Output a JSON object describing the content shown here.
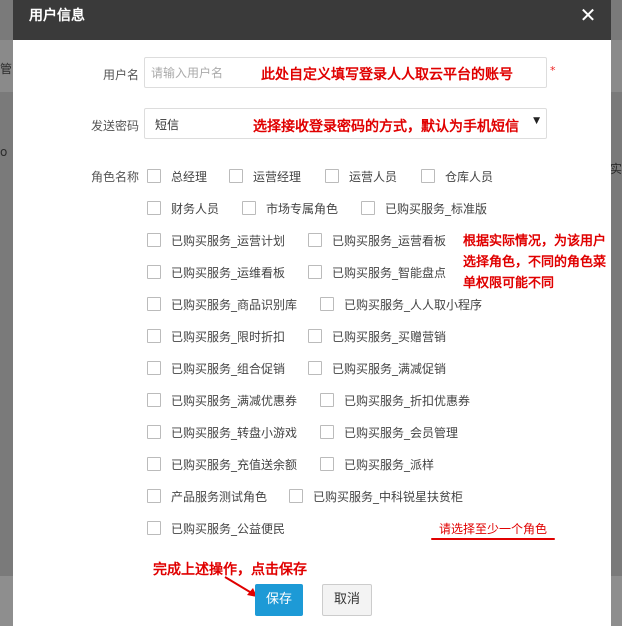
{
  "background": {
    "left_text": "管",
    "left_text2": "o",
    "right_text": "实"
  },
  "modal": {
    "title": "用户信息",
    "close_icon": "close-icon"
  },
  "form": {
    "username": {
      "label": "用户名",
      "placeholder": "请输入用户名",
      "required_mark": "*",
      "annotation": "此处自定义填写登录人人取云平台的账号"
    },
    "password_send": {
      "label": "发送密码",
      "value": "短信",
      "arrow": "▼",
      "annotation": "选择接收登录密码的方式，默认为手机短信"
    },
    "roles": {
      "label": "角色名称",
      "note": "根据实际情况，为该用户选择角色，不同的角色菜单权限可能不同",
      "hint": "请选择至少一个角色",
      "items": [
        "总经理",
        "运营经理",
        "运营人员",
        "仓库人员",
        "财务人员",
        "市场专属角色",
        "已购买服务_标准版",
        "已购买服务_运营计划",
        "已购买服务_运营看板",
        "已购买服务_运维看板",
        "已购买服务_智能盘点",
        "已购买服务_商品识别库",
        "已购买服务_人人取小程序",
        "已购买服务_限时折扣",
        "已购买服务_买赠营销",
        "已购买服务_组合促销",
        "已购买服务_满减促销",
        "已购买服务_满减优惠券",
        "已购买服务_折扣优惠券",
        "已购买服务_转盘小游戏",
        "已购买服务_会员管理",
        "已购买服务_充值送余额",
        "已购买服务_派样",
        "产品服务测试角色",
        "已购买服务_中科锐星扶贫柜",
        "已购买服务_公益便民"
      ]
    }
  },
  "footer": {
    "annotation": "完成上述操作，点击保存",
    "save_label": "保存",
    "cancel_label": "取消"
  },
  "colors": {
    "accent": "#1d9ad6",
    "annotation": "#e00000",
    "header": "#3a3a3a"
  }
}
